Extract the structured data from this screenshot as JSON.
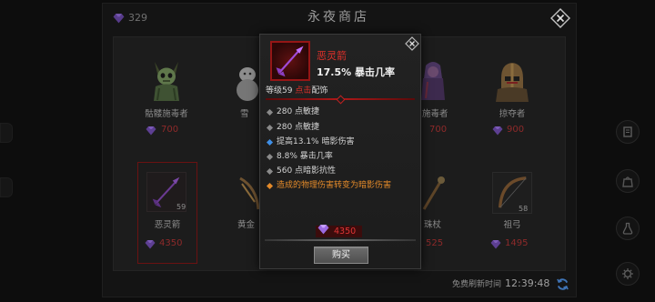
{
  "shop": {
    "title": "永夜商店",
    "currency": {
      "amount": "329",
      "icon": "purple-gem-icon"
    },
    "close_icon": "close-icon",
    "items": [
      {
        "name": "骷髅施毒者",
        "price": "700",
        "icon": "skull-poisoner-icon"
      },
      {
        "name": "雪",
        "icon": "snow-beast-icon"
      },
      {
        "name": "施毒者",
        "price": "700",
        "icon": "poisoner-icon"
      },
      {
        "name": "掠夺者",
        "price": "900",
        "icon": "marauder-helmet-icon"
      },
      {
        "name": "恶灵箭",
        "price": "4350",
        "level": "59",
        "icon": "purple-arrow-icon",
        "selected": true
      },
      {
        "name": "黄金",
        "icon": "golden-crossbow-icon"
      },
      {
        "name": "珠杖",
        "price": "525",
        "icon": "orb-staff-icon"
      },
      {
        "name": "祖弓",
        "price": "1495",
        "level": "58",
        "icon": "ancestral-bow-icon"
      }
    ],
    "refresh": {
      "label": "免费刷新时间",
      "time": "12:39:48",
      "icon": "refresh-icon"
    }
  },
  "side_menu": [
    {
      "icon": "scroll-icon"
    },
    {
      "icon": "bag-icon"
    },
    {
      "icon": "potion-icon"
    },
    {
      "icon": "gear-icon"
    }
  ],
  "popup": {
    "item_icon": "purple-arrow-icon",
    "item_name": "恶灵箭",
    "headline_stat": "17.5% 暴击几率",
    "level": "等级59",
    "rarity": "点击",
    "slot": "配饰",
    "stats": [
      {
        "text": "280 点敏捷",
        "bullet_color": "#8a8a8a"
      },
      {
        "text": "280 点敏捷",
        "bullet_color": "#8a8a8a"
      },
      {
        "text": "提高13.1% 暗影伤害",
        "bullet_color": "#3f8fe6"
      },
      {
        "text": "8.8% 暴击几率",
        "bullet_color": "#8a8a8a"
      },
      {
        "text": "560 点暗影抗性",
        "bullet_color": "#8a8a8a"
      },
      {
        "text": "造成的物理伤害转变为暗影伤害",
        "bullet_color": "#e38a2a",
        "color": "#e38a2a"
      }
    ],
    "price": "4350",
    "currency_icon": "purple-gem-icon",
    "buy_label": "购买",
    "close_icon": "close-icon"
  },
  "colors": {
    "rarity_red": "#e0302a",
    "stat_text": "#d4d4d4",
    "special_stat": "#e38a2a",
    "gem_purple": "#9b6ae0",
    "price_red": "#e03535",
    "popup_bg": "#1e1e1e",
    "button_bg": "#5e5e5e"
  }
}
